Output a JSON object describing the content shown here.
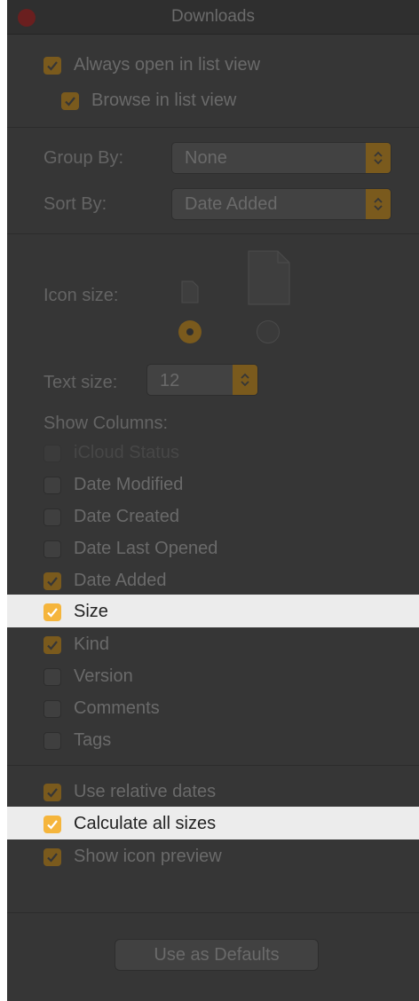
{
  "window": {
    "title": "Downloads"
  },
  "view_options": {
    "always_open_list_view": {
      "label": "Always open in list view",
      "checked": true
    },
    "browse_list_view": {
      "label": "Browse in list view",
      "checked": true
    },
    "group_by": {
      "label": "Group By:",
      "value": "None"
    },
    "sort_by": {
      "label": "Sort By:",
      "value": "Date Added"
    },
    "icon_size": {
      "label": "Icon size:",
      "selected": "small"
    },
    "text_size": {
      "label": "Text size:",
      "value": "12"
    },
    "show_columns_label": "Show Columns:"
  },
  "columns": [
    {
      "label": "iCloud Status",
      "checked": false,
      "enabled": false
    },
    {
      "label": "Date Modified",
      "checked": false,
      "enabled": true
    },
    {
      "label": "Date Created",
      "checked": false,
      "enabled": true
    },
    {
      "label": "Date Last Opened",
      "checked": false,
      "enabled": true
    },
    {
      "label": "Date Added",
      "checked": true,
      "enabled": true
    },
    {
      "label": "Size",
      "checked": true,
      "enabled": true,
      "highlighted": true
    },
    {
      "label": "Kind",
      "checked": true,
      "enabled": true
    },
    {
      "label": "Version",
      "checked": false,
      "enabled": true
    },
    {
      "label": "Comments",
      "checked": false,
      "enabled": true
    },
    {
      "label": "Tags",
      "checked": false,
      "enabled": true
    }
  ],
  "options": [
    {
      "label": "Use relative dates",
      "checked": true
    },
    {
      "label": "Calculate all sizes",
      "checked": true,
      "highlighted": true
    },
    {
      "label": "Show icon preview",
      "checked": true
    }
  ],
  "defaults_button": "Use as Defaults",
  "colors": {
    "accent": "#f5b53c",
    "dimmed_accent": "#7a5a1d",
    "window_bg": "#363636",
    "highlight_bg": "#ececec"
  }
}
